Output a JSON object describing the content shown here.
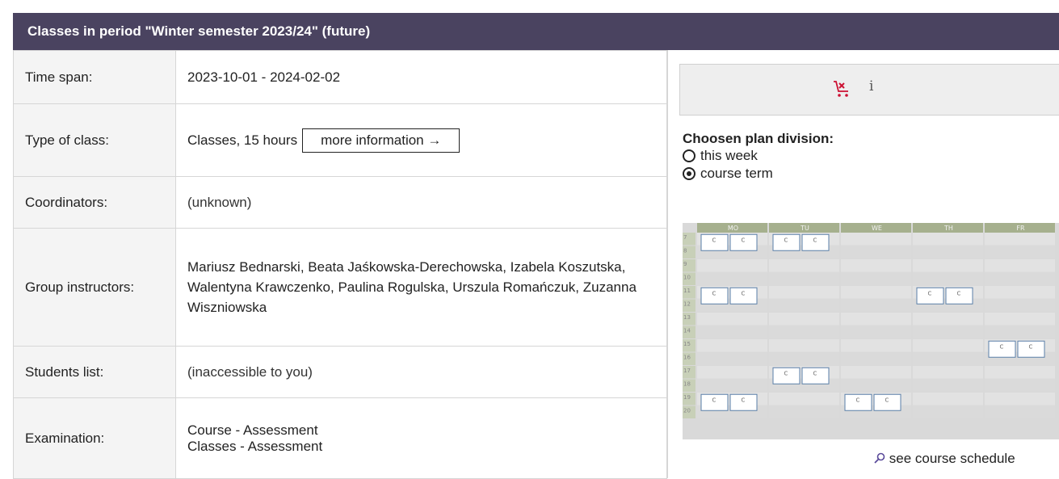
{
  "header": {
    "title": "Classes in period \"Winter semester 2023/24\" (future)"
  },
  "rows": {
    "time_span": {
      "label": "Time span:",
      "value": "2023-10-01 - 2024-02-02"
    },
    "type_of_class": {
      "label": "Type of class:",
      "value": "Classes, 15 hours",
      "button": "more information →"
    },
    "coordinators": {
      "label": "Coordinators:",
      "value": "(unknown)"
    },
    "group_instructors": {
      "label": "Group instructors:",
      "value": "Mariusz Bednarski, Beata Jaśkowska-Derechowska, Izabela Koszutska, Walentyna Krawczenko, Paulina Rogulska, Urszula Romańczuk, Zuzanna Wiszniowska"
    },
    "students_list": {
      "label": "Students list:",
      "value": "(inaccessible to you)"
    },
    "examination": {
      "label": "Examination:",
      "line1": "Course - Assessment",
      "line2": "Classes - Assessment"
    }
  },
  "right": {
    "cart_icon": "cart-remove-icon",
    "info_icon_text": "i",
    "division_title": "Choosen plan division:",
    "options": [
      {
        "label": "this week",
        "checked": false
      },
      {
        "label": "course term",
        "checked": true
      }
    ],
    "schedule": {
      "days": [
        "MO",
        "TU",
        "WE",
        "TH",
        "FR"
      ],
      "hours": [
        "7",
        "8",
        "9",
        "10",
        "11",
        "12",
        "13",
        "14",
        "15",
        "16",
        "17",
        "18",
        "19",
        "20"
      ],
      "block_label": "C",
      "blocks": [
        {
          "day": 0,
          "hour": 7.5,
          "count": 2
        },
        {
          "day": 1,
          "hour": 7.5,
          "count": 2
        },
        {
          "day": 0,
          "hour": 11.5,
          "count": 2
        },
        {
          "day": 3,
          "hour": 11.5,
          "count": 2
        },
        {
          "day": 4,
          "hour": 15.5,
          "count": 2
        },
        {
          "day": 1,
          "hour": 17.5,
          "count": 2
        },
        {
          "day": 0,
          "hour": 19.5,
          "count": 2
        },
        {
          "day": 2,
          "hour": 19.5,
          "count": 2
        }
      ]
    },
    "schedule_link": "see course schedule"
  },
  "colors": {
    "header_bg": "#4a4360",
    "cart_red": "#cc1133",
    "link_icon": "#5a4a9a"
  }
}
